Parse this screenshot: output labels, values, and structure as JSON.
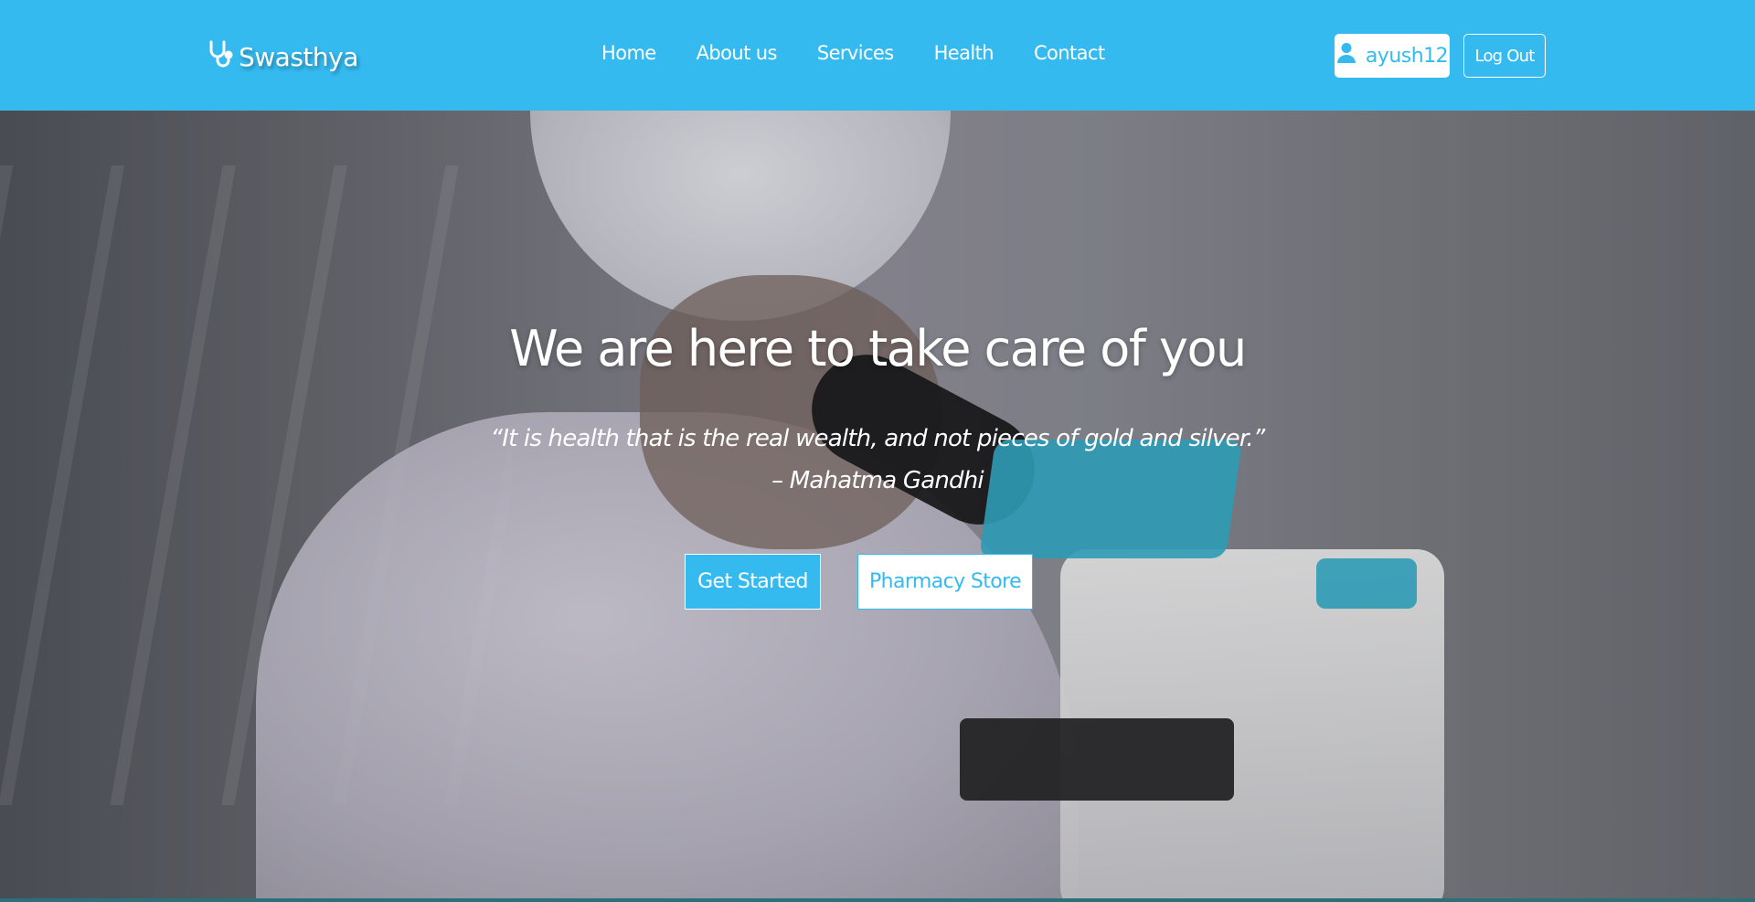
{
  "navbar": {
    "brand": {
      "name": "Swasthya",
      "icon": "stethoscope-icon"
    },
    "links": [
      "Home",
      "About us",
      "Services",
      "Health",
      "Contact"
    ],
    "user": {
      "username": "ayush12",
      "icon": "user-icon"
    },
    "logout_label": "Log Out",
    "background_color": "#35baf0"
  },
  "hero": {
    "title": "We are here to take care of you",
    "quote_line1": "“It is health that is the real wealth, and not pieces of gold and silver.”",
    "quote_line2": "– Mahatma Gandhi",
    "primary_button": "Get Started",
    "secondary_button": "Pharmacy Store"
  },
  "colors": {
    "accent": "#35baf0",
    "text_on_accent": "#ffffff"
  }
}
